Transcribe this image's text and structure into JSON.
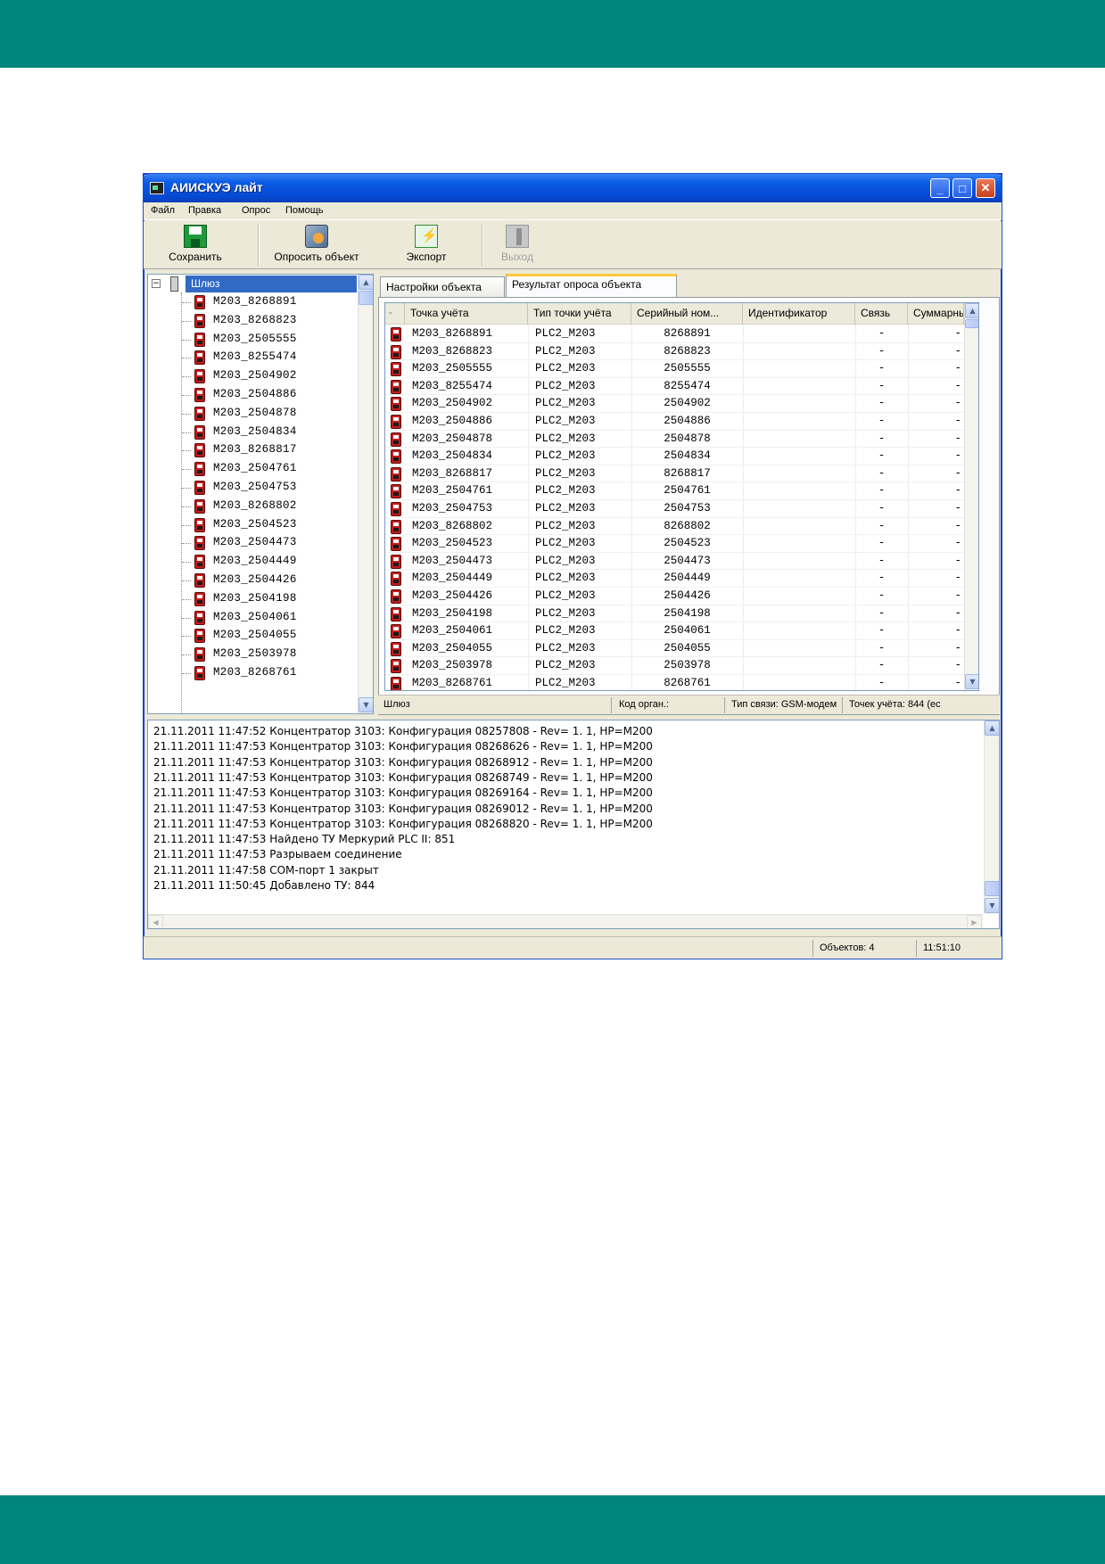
{
  "window": {
    "title": "АИИСКУЭ лайт"
  },
  "menu": [
    "Файл",
    "Правка",
    "Опрос",
    "Помощь"
  ],
  "toolbar": {
    "save": "Сохранить",
    "poll": "Опросить объект",
    "export": "Экспорт",
    "exit": "Выход"
  },
  "tree": {
    "root": "Шлюз",
    "items": [
      "M203_8268891",
      "M203_8268823",
      "M203_2505555",
      "M203_8255474",
      "M203_2504902",
      "M203_2504886",
      "M203_2504878",
      "M203_2504834",
      "M203_8268817",
      "M203_2504761",
      "M203_2504753",
      "M203_8268802",
      "M203_2504523",
      "M203_2504473",
      "M203_2504449",
      "M203_2504426",
      "M203_2504198",
      "M203_2504061",
      "M203_2504055",
      "M203_2503978",
      "M203_8268761"
    ]
  },
  "tabs": [
    "Настройки объекта",
    "Результат опроса объекта"
  ],
  "grid": {
    "columns": [
      "Точка учёта",
      "Тип точки учёта",
      "Серийный ном...",
      "Идентификатор",
      "Связь",
      "Суммарнь"
    ],
    "rows": [
      [
        "M203_8268891",
        "PLC2_M203",
        "8268891",
        "",
        "-",
        "-"
      ],
      [
        "M203_8268823",
        "PLC2_M203",
        "8268823",
        "",
        "-",
        "-"
      ],
      [
        "M203_2505555",
        "PLC2_M203",
        "2505555",
        "",
        "-",
        "-"
      ],
      [
        "M203_8255474",
        "PLC2_M203",
        "8255474",
        "",
        "-",
        "-"
      ],
      [
        "M203_2504902",
        "PLC2_M203",
        "2504902",
        "",
        "-",
        "-"
      ],
      [
        "M203_2504886",
        "PLC2_M203",
        "2504886",
        "",
        "-",
        "-"
      ],
      [
        "M203_2504878",
        "PLC2_M203",
        "2504878",
        "",
        "-",
        "-"
      ],
      [
        "M203_2504834",
        "PLC2_M203",
        "2504834",
        "",
        "-",
        "-"
      ],
      [
        "M203_8268817",
        "PLC2_M203",
        "8268817",
        "",
        "-",
        "-"
      ],
      [
        "M203_2504761",
        "PLC2_M203",
        "2504761",
        "",
        "-",
        "-"
      ],
      [
        "M203_2504753",
        "PLC2_M203",
        "2504753",
        "",
        "-",
        "-"
      ],
      [
        "M203_8268802",
        "PLC2_M203",
        "8268802",
        "",
        "-",
        "-"
      ],
      [
        "M203_2504523",
        "PLC2_M203",
        "2504523",
        "",
        "-",
        "-"
      ],
      [
        "M203_2504473",
        "PLC2_M203",
        "2504473",
        "",
        "-",
        "-"
      ],
      [
        "M203_2504449",
        "PLC2_M203",
        "2504449",
        "",
        "-",
        "-"
      ],
      [
        "M203_2504426",
        "PLC2_M203",
        "2504426",
        "",
        "-",
        "-"
      ],
      [
        "M203_2504198",
        "PLC2_M203",
        "2504198",
        "",
        "-",
        "-"
      ],
      [
        "M203_2504061",
        "PLC2_M203",
        "2504061",
        "",
        "-",
        "-"
      ],
      [
        "M203_2504055",
        "PLC2_M203",
        "2504055",
        "",
        "-",
        "-"
      ],
      [
        "M203_2503978",
        "PLC2_M203",
        "2503978",
        "",
        "-",
        "-"
      ],
      [
        "M203_8268761",
        "PLC2_M203",
        "8268761",
        "",
        "-",
        "-"
      ]
    ]
  },
  "panel_status": {
    "node": "Шлюз",
    "code": "Код орган.:",
    "link_type": "Тип связи: GSM-модем",
    "points": "Точек учёта: 844 (ес"
  },
  "log": [
    "21.11.2011 11:47:52  Концентратор 3103: Конфигурация 08257808 - Rev= 1. 1, HP=M200",
    "21.11.2011 11:47:53  Концентратор 3103: Конфигурация 08268626 - Rev= 1. 1, HP=M200",
    "21.11.2011 11:47:53  Концентратор 3103: Конфигурация 08268912 - Rev= 1. 1, HP=M200",
    "21.11.2011 11:47:53  Концентратор 3103: Конфигурация 08268749 - Rev= 1. 1, HP=M200",
    "21.11.2011 11:47:53  Концентратор 3103: Конфигурация 08269164 - Rev= 1. 1, HP=M200",
    "21.11.2011 11:47:53  Концентратор 3103: Конфигурация 08269012 - Rev= 1. 1, HP=M200",
    "21.11.2011 11:47:53  Концентратор 3103: Конфигурация 08268820 - Rev= 1. 1, HP=M200",
    "21.11.2011 11:47:53  Найдено ТУ Меркурий PLC II: 851",
    "21.11.2011 11:47:53  Разрываем соединение",
    "21.11.2011 11:47:58  COM-порт 1 закрыт",
    "21.11.2011 11:50:45  Добавлено ТУ: 844"
  ],
  "statusbar": {
    "objects": "Объектов: 4",
    "time": "11:51:10"
  },
  "colors": {
    "band": "#00857c",
    "title_bar": "#0549d3",
    "selection": "#316ac5",
    "meter_icon": "#c41b1b"
  }
}
